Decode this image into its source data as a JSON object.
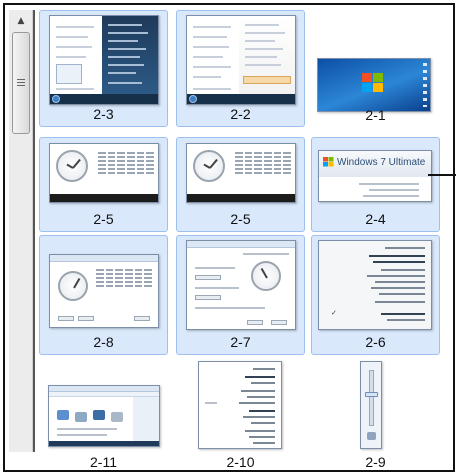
{
  "scrollbar": {
    "up_arrow_icon": "triangle-up"
  },
  "tiles": [
    {
      "id": "2-1",
      "caption": "2-1",
      "selected": false,
      "kind": "desktop"
    },
    {
      "id": "2-2",
      "caption": "2-2",
      "selected": true,
      "kind": "start-menu"
    },
    {
      "id": "2-3",
      "caption": "2-3",
      "selected": true,
      "kind": "start-menu"
    },
    {
      "id": "2-4",
      "caption": "2-4",
      "selected": true,
      "kind": "about-windows",
      "banner_text": "Windows 7 Ultimate"
    },
    {
      "id": "2-5b",
      "caption": "2-5",
      "selected": true,
      "kind": "calendar"
    },
    {
      "id": "2-5a",
      "caption": "2-5",
      "selected": true,
      "kind": "calendar"
    },
    {
      "id": "2-6",
      "caption": "2-6",
      "selected": true,
      "kind": "context-menu"
    },
    {
      "id": "2-7",
      "caption": "2-7",
      "selected": true,
      "kind": "date-dialog"
    },
    {
      "id": "2-8",
      "caption": "2-8",
      "selected": true,
      "kind": "date-dialog-calendar"
    },
    {
      "id": "2-9",
      "caption": "2-9",
      "selected": false,
      "kind": "volume-slider"
    },
    {
      "id": "2-10",
      "caption": "2-10",
      "selected": false,
      "kind": "menu"
    },
    {
      "id": "2-11",
      "caption": "2-11",
      "selected": false,
      "kind": "control-panel"
    }
  ],
  "colors": {
    "selection_fill": "#d9e8fb",
    "selection_border": "#9dc1ee",
    "desktop_blue": "#1f6fc7"
  }
}
